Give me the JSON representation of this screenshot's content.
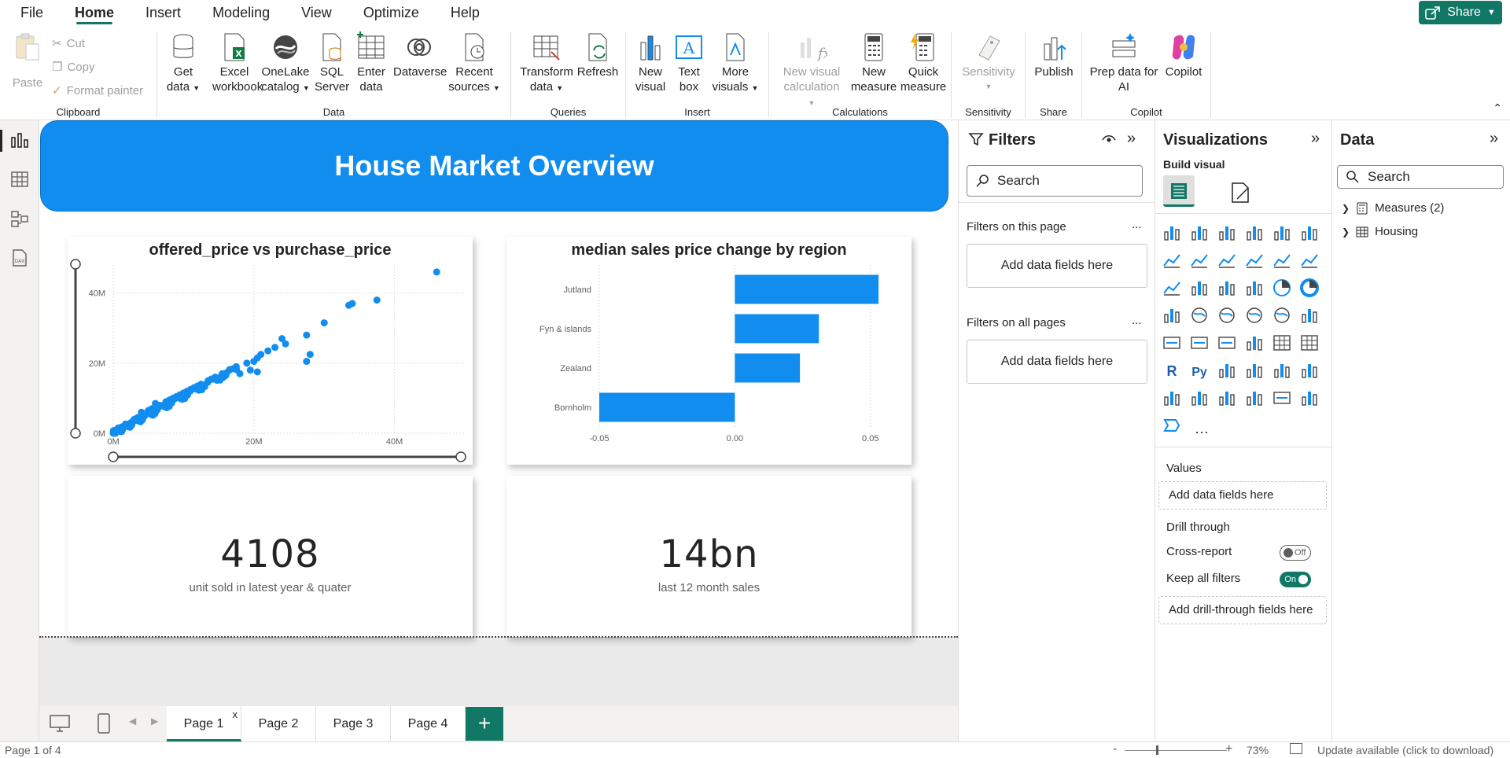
{
  "menu": {
    "items": [
      {
        "label": "File"
      },
      {
        "label": "Home"
      },
      {
        "label": "Insert"
      },
      {
        "label": "Modeling"
      },
      {
        "label": "View"
      },
      {
        "label": "Optimize"
      },
      {
        "label": "Help"
      }
    ],
    "share_label": "Share"
  },
  "ribbon": {
    "clipboard": {
      "paste": "Paste",
      "cut": "Cut",
      "copy": "Copy",
      "format_painter": "Format painter",
      "group": "Clipboard"
    },
    "data": {
      "get_data_1": "Get",
      "get_data_2": "data",
      "excel_1": "Excel",
      "excel_2": "workbook",
      "onelake_1": "OneLake",
      "onelake_2": "catalog",
      "sql_1": "SQL",
      "sql_2": "Server",
      "enter_1": "Enter",
      "enter_2": "data",
      "dataverse": "Dataverse",
      "recent_1": "Recent",
      "recent_2": "sources",
      "group": "Data"
    },
    "queries": {
      "transform_1": "Transform",
      "transform_2": "data",
      "refresh": "Refresh",
      "group": "Queries"
    },
    "insert": {
      "new_visual_1": "New",
      "new_visual_2": "visual",
      "text_box_1": "Text",
      "text_box_2": "box",
      "more_visuals_1": "More",
      "more_visuals_2": "visuals",
      "group": "Insert"
    },
    "calculations": {
      "new_visual_calc_1": "New visual",
      "new_visual_calc_2": "calculation",
      "new_measure_1": "New",
      "new_measure_2": "measure",
      "quick_measure_1": "Quick",
      "quick_measure_2": "measure",
      "group": "Calculations"
    },
    "sensitivity": {
      "label": "Sensitivity",
      "group": "Sensitivity"
    },
    "share": {
      "publish": "Publish",
      "group": "Share"
    },
    "copilot": {
      "prep_1": "Prep data for",
      "prep_2": "AI",
      "copilot": "Copilot",
      "group": "Copilot"
    }
  },
  "report": {
    "title": "House Market Overview",
    "scatter_title": "offered_price vs purchase_price",
    "bar_title": "median sales price change by region",
    "card1": {
      "value": "4108",
      "label": "unit sold in latest year & quater"
    },
    "card2": {
      "value": "14bn",
      "label": "last 12  month sales"
    }
  },
  "chart_data": [
    {
      "type": "scatter",
      "title": "offered_price vs purchase_price",
      "xlabel": "",
      "ylabel": "",
      "x_ticks": [
        "0M",
        "20M",
        "40M"
      ],
      "y_ticks": [
        "0M",
        "20M",
        "40M"
      ],
      "xlim": [
        0,
        50
      ],
      "ylim": [
        0,
        48
      ],
      "color": "#118df0",
      "points": [
        [
          46,
          46
        ],
        [
          37.5,
          38
        ],
        [
          34,
          37
        ],
        [
          33.5,
          36.5
        ],
        [
          30,
          31.5
        ],
        [
          27.5,
          28
        ],
        [
          24,
          27
        ],
        [
          24.5,
          25.5
        ],
        [
          23,
          24.5
        ],
        [
          22,
          23.5
        ],
        [
          21,
          22.5
        ],
        [
          20.5,
          21.5
        ],
        [
          20,
          20.5
        ],
        [
          19,
          20
        ],
        [
          17.5,
          19
        ],
        [
          16.5,
          18
        ],
        [
          15.5,
          17
        ],
        [
          14.5,
          16
        ],
        [
          13.5,
          15
        ],
        [
          12.5,
          14
        ],
        [
          11.5,
          13
        ],
        [
          10.5,
          12
        ],
        [
          9.5,
          11
        ],
        [
          8.5,
          10
        ],
        [
          7.5,
          9
        ],
        [
          6.5,
          8
        ],
        [
          5.5,
          7
        ],
        [
          4.5,
          5.5
        ],
        [
          3.5,
          4.5
        ],
        [
          2.5,
          3
        ],
        [
          2,
          2.5
        ],
        [
          1.5,
          2
        ],
        [
          1,
          1.3
        ],
        [
          0.6,
          0.8
        ],
        [
          0.3,
          0.4
        ],
        [
          28,
          22.5
        ],
        [
          27.5,
          20.5
        ],
        [
          20.5,
          17.5
        ],
        [
          19.5,
          18
        ],
        [
          18,
          17
        ],
        [
          9,
          10.5
        ],
        [
          8,
          9.5
        ],
        [
          6,
          8.5
        ],
        [
          5,
          6.5
        ],
        [
          4,
          6
        ],
        [
          3,
          4
        ],
        [
          2.8,
          3.5
        ],
        [
          1.8,
          2.6
        ],
        [
          1.2,
          1.8
        ],
        [
          0.8,
          1.0
        ],
        [
          16,
          16.5
        ],
        [
          14,
          15.5
        ],
        [
          12,
          13.5
        ],
        [
          11,
          12.5
        ],
        [
          10,
          11.5
        ],
        [
          13,
          13.8
        ],
        [
          15,
          15.8
        ]
      ]
    },
    {
      "type": "bar",
      "orientation": "horizontal",
      "title": "median sales price change by region",
      "categories": [
        "Jutland",
        "Fyn & islands",
        "Zealand",
        "Bornholm"
      ],
      "values": [
        0.053,
        0.031,
        0.024,
        -0.05
      ],
      "x_ticks": [
        "-0.05",
        "0.00",
        "0.05"
      ],
      "xlim": [
        -0.05,
        0.055
      ],
      "color": "#118df0"
    }
  ],
  "tabs": [
    {
      "label": "Page 1"
    },
    {
      "label": "Page 2"
    },
    {
      "label": "Page 3"
    },
    {
      "label": "Page 4"
    }
  ],
  "tab_close": "x",
  "add_page": "+",
  "status": {
    "page": "Page 1 of 4",
    "zoom": "73%",
    "update": "Update available (click to download)"
  },
  "filters": {
    "title": "Filters",
    "search_placeholder": "Search",
    "on_this_page": "Filters on this page",
    "on_all_pages": "Filters on all pages",
    "add_fields": "Add data fields here",
    "more": "..."
  },
  "visualizations": {
    "title": "Visualizations",
    "build_visual": "Build visual",
    "more": "···",
    "values_label": "Values",
    "values_drop": "Add data fields here",
    "drill_through": "Drill through",
    "cross_report": "Cross-report",
    "cross_report_state": "Off",
    "keep_filters": "Keep all filters",
    "keep_filters_state": "On",
    "drill_drop": "Add drill-through fields here",
    "r_label": "R",
    "py_label": "Py"
  },
  "data_pane": {
    "title": "Data",
    "search_placeholder": "Search",
    "items": [
      {
        "label": "Measures (2)"
      },
      {
        "label": "Housing"
      }
    ]
  },
  "colors": {
    "accent": "#117865",
    "chart_blue": "#118df0",
    "banner_blue": "#118df0"
  }
}
